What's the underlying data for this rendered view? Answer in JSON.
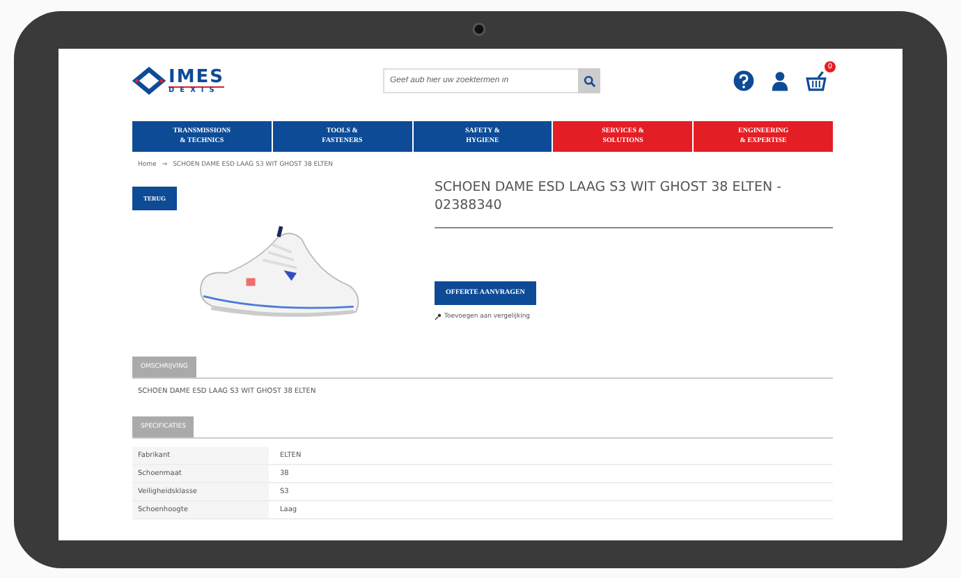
{
  "header": {
    "logo": {
      "name": "IMES",
      "sub": "DEXIS"
    },
    "search": {
      "placeholder": "Geef aub hier uw zoektermen in"
    },
    "cart_count": "0"
  },
  "nav": [
    {
      "label": "TRANSMISSIONS\n& TECHNICS",
      "color": "#0d4b96"
    },
    {
      "label": "TOOLS &\nFASTENERS",
      "color": "#0d4b96"
    },
    {
      "label": "SAFETY &\nHYGIENE",
      "color": "#0d4b96"
    },
    {
      "label": "SERVICES &\nSOLUTIONS",
      "color": "#e31e24"
    },
    {
      "label": "ENGINEERING\n& EXPERTISE",
      "color": "#e31e24"
    }
  ],
  "breadcrumb": {
    "items": [
      "Home",
      "SCHOEN DAME ESD LAAG S3 WIT GHOST 38 ELTEN"
    ],
    "separator": "→"
  },
  "product": {
    "back_button": "TERUG",
    "title": "SCHOEN DAME ESD LAAG S3 WIT GHOST 38 ELTEN - 02388340",
    "quote_button": "OFFERTE AANVRAGEN",
    "compare_link": "Toevoegen aan vergelijking"
  },
  "description": {
    "tab": "OMSCHRIJVING",
    "text": "SCHOEN DAME ESD LAAG S3 WIT GHOST 38 ELTEN"
  },
  "specifications": {
    "tab": "SPECIFICATIES",
    "rows": [
      {
        "name": "Fabrikant",
        "value": "ELTEN"
      },
      {
        "name": "Schoenmaat",
        "value": "38"
      },
      {
        "name": "Veiligheidsklasse",
        "value": "S3"
      },
      {
        "name": "Schoenhoogte",
        "value": "Laag"
      }
    ]
  }
}
